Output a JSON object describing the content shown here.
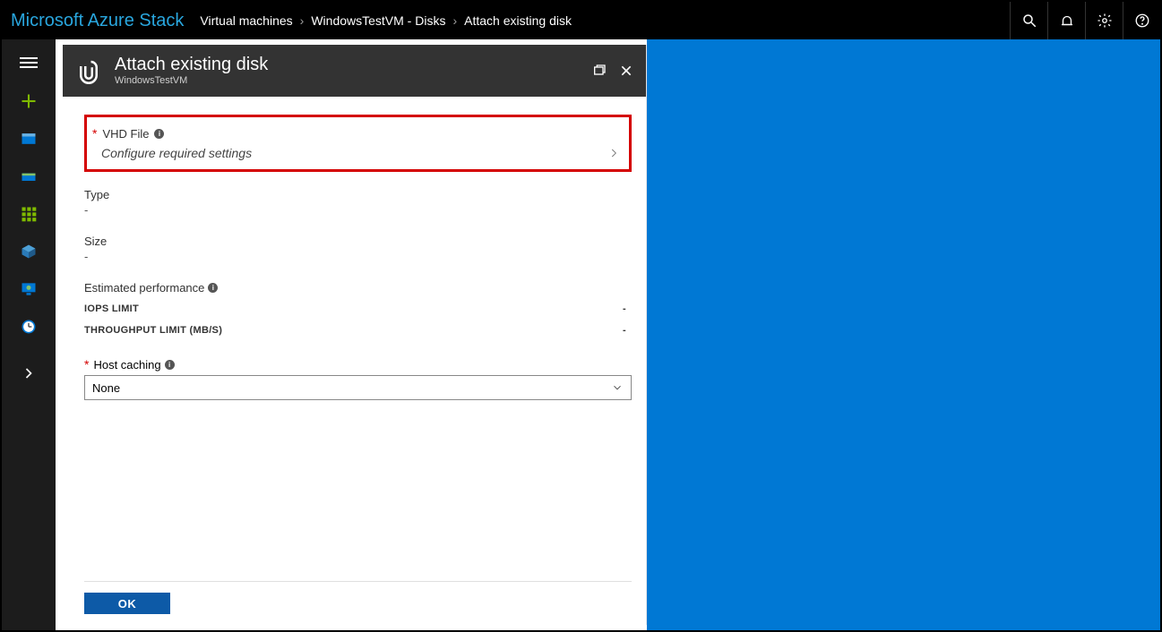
{
  "product_name": "Microsoft Azure Stack",
  "breadcrumbs": [
    "Virtual machines",
    "WindowsTestVM - Disks",
    "Attach existing disk"
  ],
  "blade": {
    "title": "Attach existing disk",
    "subtitle": "WindowsTestVM",
    "vhd": {
      "label": "VHD File",
      "placeholder": "Configure required settings"
    },
    "type": {
      "label": "Type",
      "value": "-"
    },
    "size": {
      "label": "Size",
      "value": "-"
    },
    "perf": {
      "heading": "Estimated performance",
      "iops": {
        "label": "IOPS LIMIT",
        "value": "-"
      },
      "throughput": {
        "label": "THROUGHPUT LIMIT (MB/S)",
        "value": "-"
      }
    },
    "host_caching": {
      "label": "Host caching",
      "value": "None"
    },
    "ok_label": "OK"
  }
}
